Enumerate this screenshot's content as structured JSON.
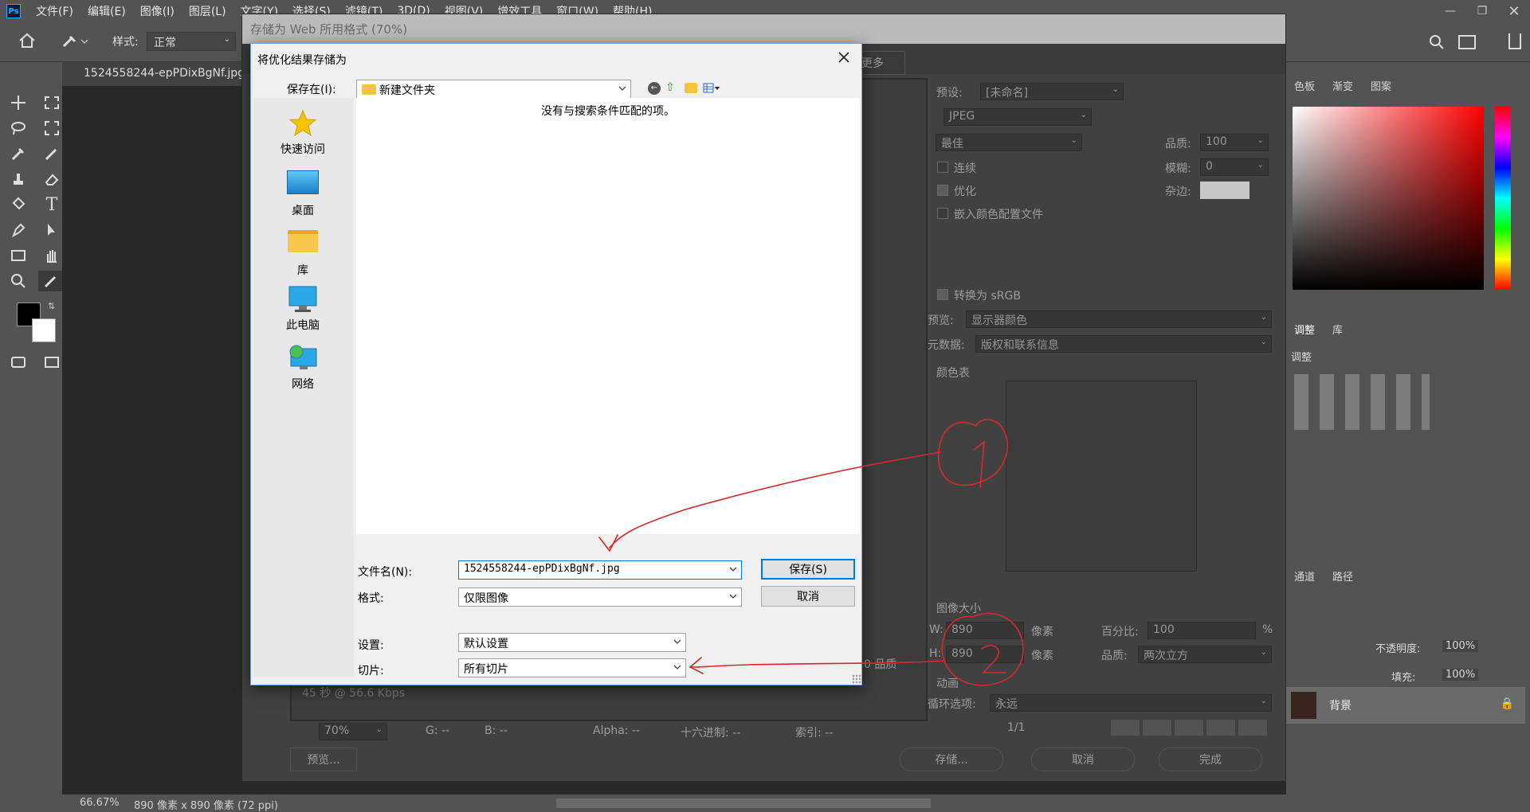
{
  "app": {
    "logo": "Ps"
  },
  "menu": [
    "文件(F)",
    "编辑(E)",
    "图像(I)",
    "图层(L)",
    "文字(Y)",
    "选择(S)",
    "滤镜(T)",
    "3D(D)",
    "视图(V)",
    "增效工具",
    "窗口(W)",
    "帮助(H)"
  ],
  "options": {
    "style_label": "样式:",
    "style_value": "正常"
  },
  "document": {
    "tab_title": "1524558244-epPDixBgNf.jpg @"
  },
  "status": {
    "zoom": "66.67%",
    "size": "890 像素 x 890 像素 (72 ppi)"
  },
  "right_panel": {
    "tabs_top": [
      "色板",
      "渐变",
      "图案"
    ],
    "tabs_adjust": [
      "调整",
      "库"
    ],
    "adjust_heading": "调整",
    "tabs_layers": [
      "通道",
      "路径"
    ],
    "opacity_label": "不透明度:",
    "opacity_value": "100%",
    "fill_label": "填充:",
    "fill_value": "100%",
    "layer_name": "背景"
  },
  "sfw": {
    "title": "存储为 Web 所用格式 (70%)",
    "more_label": "更多",
    "preset_label": "预设:",
    "preset_value": "[未命名]",
    "format_value": "JPEG",
    "quality_preset": "最佳",
    "quality_label": "品质:",
    "quality_value": "100",
    "progressive": "连续",
    "blur_label": "模糊:",
    "blur_value": "0",
    "optimized": "优化",
    "matte_label": "杂边:",
    "embed_profile": "嵌入颜色配置文件",
    "convert_srgb": "转换为 sRGB",
    "preview_label": "预览:",
    "preview_value": "显示器颜色",
    "metadata_label": "元数据:",
    "metadata_value": "版权和联系信息",
    "color_table": "颜色表",
    "image_size": "图像大小",
    "w_label": "W:",
    "w_value": "890",
    "h_label": "H:",
    "h_value": "890",
    "px": "像素",
    "percent_label": "百分比:",
    "percent_value": "100",
    "percent_unit": "%",
    "resample_label": "品质:",
    "resample_value": "两次立方",
    "animation": "动画",
    "loop_label": "循环选项:",
    "loop_value": "永远",
    "frame": "1/1",
    "info_left": "45 秒 @ 56.6 Kbps",
    "quality_tag": "0 品质",
    "zoom_value": "70%",
    "g_label": "G: --",
    "b_label": "B: --",
    "alpha_label": "Alpha: --",
    "hex_label": "十六进制: --",
    "index_label": "索引: --",
    "preview_btn": "预览...",
    "save_btn": "存储...",
    "cancel_btn": "取消",
    "done_btn": "完成"
  },
  "save_dialog": {
    "title": "将优化结果存储为",
    "save_in_label": "保存在(I):",
    "save_in_value": "新建文件夹",
    "empty_msg": "没有与搜索条件匹配的项。",
    "places": [
      "快速访问",
      "桌面",
      "库",
      "此电脑",
      "网络"
    ],
    "filename_label": "文件名(N):",
    "filename_value": "1524558244-epPDixBgNf.jpg",
    "format_label": "格式:",
    "format_value": "仅限图像",
    "settings_label": "设置:",
    "settings_value": "默认设置",
    "slices_label": "切片:",
    "slices_value": "所有切片",
    "save_btn": "保存(S)",
    "cancel_btn": "取消"
  },
  "colors": {
    "annotation": "#d42a2a",
    "ps_bg": "#535353",
    "dialog_bg": "#f0f0f0",
    "accent": "#0078d7"
  }
}
